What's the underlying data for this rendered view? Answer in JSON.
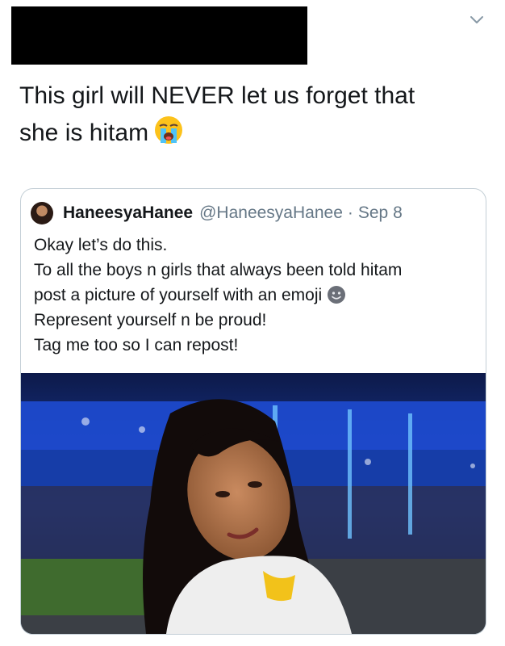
{
  "tweet": {
    "text_line1": "This girl will NEVER let us forget that",
    "text_line2": "she is hitam",
    "emoji": "loudly-crying-face-icon"
  },
  "menu": {
    "icon": "chevron-down-icon"
  },
  "quoted_tweet": {
    "display_name": "HaneesyaHanee",
    "handle": "@HaneesyaHanee",
    "separator": "·",
    "date": "Sep 8",
    "lines": [
      "Okay let’s do this.",
      "To all the boys n girls that always been told hitam",
      "post a picture of yourself with an emoji",
      "Represent yourself n be proud!",
      "Tag me too so I can repost!"
    ],
    "inline_emoji": "dark-smiley-face-icon",
    "media": "photo"
  },
  "colors": {
    "text": "#14171a",
    "secondary": "#657786",
    "border": "#c4cfd6",
    "redaction": "#000000"
  }
}
